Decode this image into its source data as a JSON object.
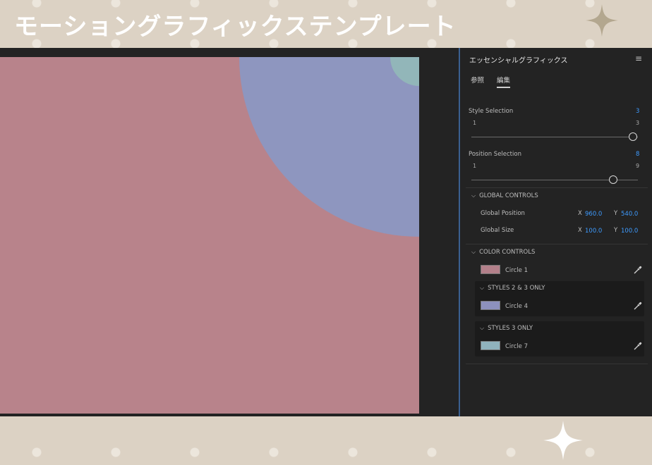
{
  "banner": {
    "title": "モーショングラフィックステンプレート"
  },
  "panel": {
    "title": "エッセンシャルグラフィックス",
    "tabs": [
      {
        "label": "参照"
      },
      {
        "label": "編集"
      }
    ],
    "style_selection": {
      "label": "Style Selection",
      "value": "3",
      "min": "1",
      "max": "3",
      "fraction": 1.0
    },
    "position_selection": {
      "label": "Position Selection",
      "value": "8",
      "min": "1",
      "max": "9",
      "fraction": 0.875
    },
    "global_controls": {
      "header": "GLOBAL CONTROLS",
      "position": {
        "label": "Global Position",
        "x_label": "X",
        "x": "960.0",
        "y_label": "Y",
        "y": "540.0"
      },
      "size": {
        "label": "Global Size",
        "x_label": "X",
        "x": "100.0",
        "y_label": "Y",
        "y": "100.0"
      }
    },
    "color_controls": {
      "header": "COLOR CONTROLS",
      "circle1": {
        "label": "Circle 1",
        "color": "#b3808a"
      },
      "styles23": {
        "header": "STYLES 2 & 3 ONLY",
        "circle4": {
          "label": "Circle 4",
          "color": "#8d91bd"
        }
      },
      "styles3": {
        "header": "STYLES 3 ONLY",
        "circle7": {
          "label": "Circle 7",
          "color": "#90b2bd"
        }
      }
    }
  },
  "colors": {
    "canvas_pink": "#b8838b",
    "circle_blue": "#8e96bf",
    "circle_teal": "#92b6b9",
    "accent_blue": "#3e9bff",
    "banner_bg": "#dcd2c4"
  }
}
